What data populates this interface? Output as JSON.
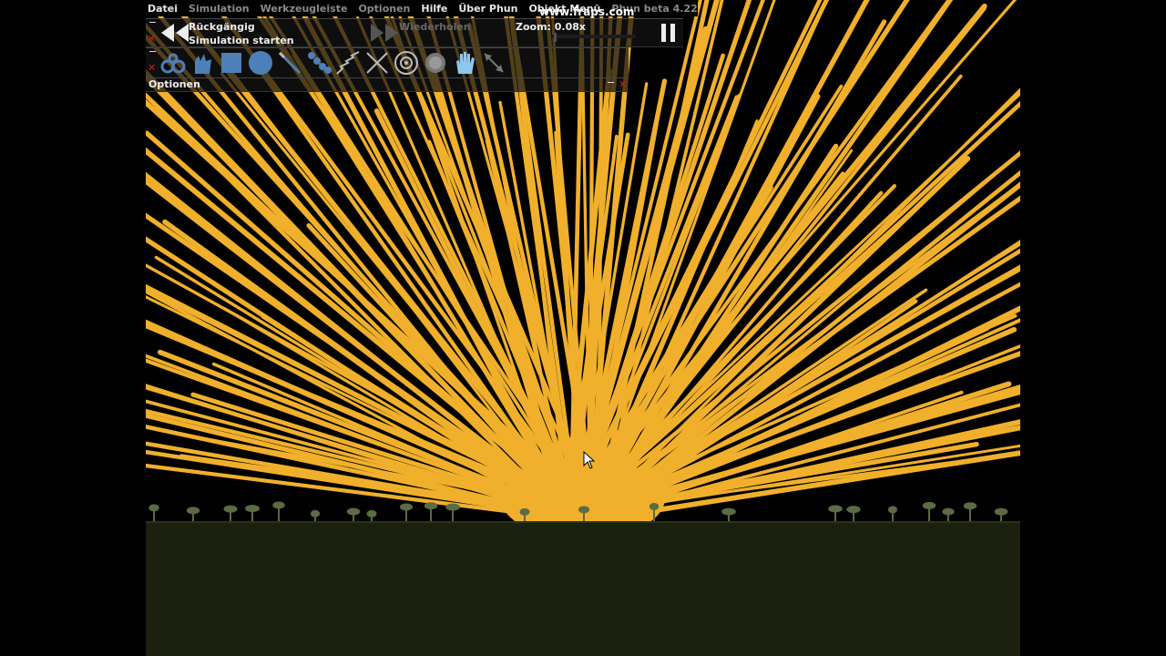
{
  "menubar": {
    "items": [
      {
        "label": "Datei",
        "active": true
      },
      {
        "label": "Simulation",
        "active": false
      },
      {
        "label": "Werkzeugleiste",
        "active": false
      },
      {
        "label": "Optionen",
        "active": false
      },
      {
        "label": "Hilfe",
        "active": true
      },
      {
        "label": "Über Phun",
        "active": true
      },
      {
        "label": "Objekt Menü",
        "active": true
      },
      {
        "label": "Phun beta 4.22",
        "active": false
      }
    ]
  },
  "watermark": "www.fraps.com",
  "simulation_panel": {
    "undo_label": "Rückgängig",
    "start_label": "Simulation starten",
    "redo_label": "Wiederholen",
    "zoom_label": "Zoom: 0.08x",
    "zoom_value": 0.08,
    "pause_icon": "pause-icon",
    "rewind_icon": "rewind-icon",
    "forward_icon": "fast-forward-icon"
  },
  "toolbar": {
    "tools": [
      "chain-tool-icon",
      "hand-drag-icon",
      "box-tool-icon",
      "circle-tool-icon",
      "brush-tool-icon",
      "spring-chain-icon",
      "zigzag-spring-icon",
      "knife-cross-icon",
      "axle-target-icon",
      "gear-icon",
      "move-hand-icon",
      "scale-arrow-icon"
    ]
  },
  "options_panel": {
    "label": "Optionen"
  },
  "colors": {
    "rays": "#f0b02c",
    "ground": "#1b200f",
    "trees": "#5a6b45",
    "sky": "#000000",
    "close_x": "#d21c1c"
  }
}
